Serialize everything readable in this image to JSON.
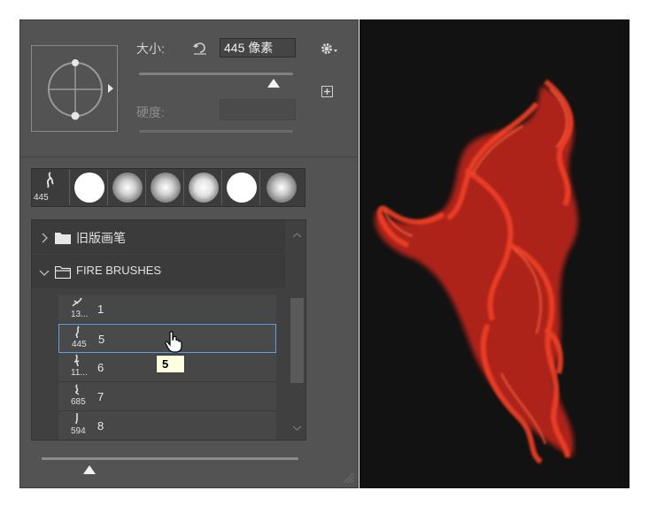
{
  "brush": {
    "size_label": "大小:",
    "size_value": "445 像素",
    "hardness_label": "硬度:"
  },
  "presets": {
    "first_size": "445"
  },
  "groups": [
    {
      "name": "旧版画笔",
      "expanded": false
    },
    {
      "name": "FIRE BRUSHES",
      "expanded": true
    }
  ],
  "brushes": [
    {
      "size": "13...",
      "name": "1",
      "selected": false
    },
    {
      "size": "445",
      "name": "5",
      "selected": true
    },
    {
      "size": "11...",
      "name": "6",
      "selected": false
    },
    {
      "size": "685",
      "name": "7",
      "selected": false
    },
    {
      "size": "594",
      "name": "8",
      "selected": false
    }
  ],
  "tooltip": "5",
  "icons": [
    "reset-size-icon",
    "gear-menu-icon",
    "new-preset-icon",
    "folder-icon",
    "open-folder-icon",
    "chevron-right-icon",
    "chevron-down-icon",
    "pointer-hand-icon",
    "resize-grip-icon"
  ],
  "colors": {
    "panel": "#535353",
    "canvas": "#121212",
    "flame": "#e8321a",
    "selection": "#5da2e0",
    "tooltip_bg": "#ffffe1"
  }
}
